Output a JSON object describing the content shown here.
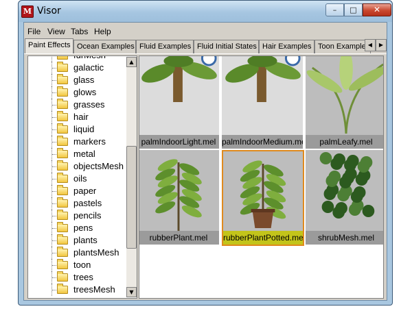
{
  "window": {
    "title": "Visor",
    "app_icon": "maya-icon"
  },
  "title_buttons": {
    "minimize": "–",
    "maximize": "□",
    "close": "✕"
  },
  "menu": [
    "File",
    "View",
    "Tabs",
    "Help"
  ],
  "tabs": [
    {
      "label": "Paint Effects",
      "active": true
    },
    {
      "label": "Ocean Examples",
      "active": false
    },
    {
      "label": "Fluid Examples",
      "active": false
    },
    {
      "label": "Fluid Initial States",
      "active": false
    },
    {
      "label": "Hair Examples",
      "active": false
    },
    {
      "label": "Toon Examples",
      "active": false
    }
  ],
  "tab_scroll": {
    "left": "◀",
    "right": "▶"
  },
  "tree": {
    "partial_top": "furMesh",
    "items": [
      "galactic",
      "glass",
      "glows",
      "grasses",
      "hair",
      "liquid",
      "markers",
      "metal",
      "objectsMesh",
      "oils",
      "paper",
      "pastels",
      "pencils",
      "pens",
      "plants",
      "plantsMesh",
      "toon",
      "trees",
      "treesMesh"
    ]
  },
  "scroll": {
    "up": "▲",
    "down": "▼"
  },
  "thumbnails": [
    {
      "caption": "palmIndoorLight.mel",
      "style": "light",
      "selected": false
    },
    {
      "caption": "palmIndoorMedium.mel",
      "style": "light",
      "selected": false
    },
    {
      "caption": "palmLeafy.mel",
      "style": "normal",
      "selected": false
    },
    {
      "caption": "rubberPlant.mel",
      "style": "normal",
      "selected": false
    },
    {
      "caption": "rubberPlantPotted.mel",
      "style": "normal",
      "selected": true
    },
    {
      "caption": "shrubMesh.mel",
      "style": "normal",
      "selected": false
    }
  ],
  "colors": {
    "selection_border": "#e08a1e",
    "selection_caption": "#c3c41a",
    "leaf": "#5a8a2a"
  }
}
